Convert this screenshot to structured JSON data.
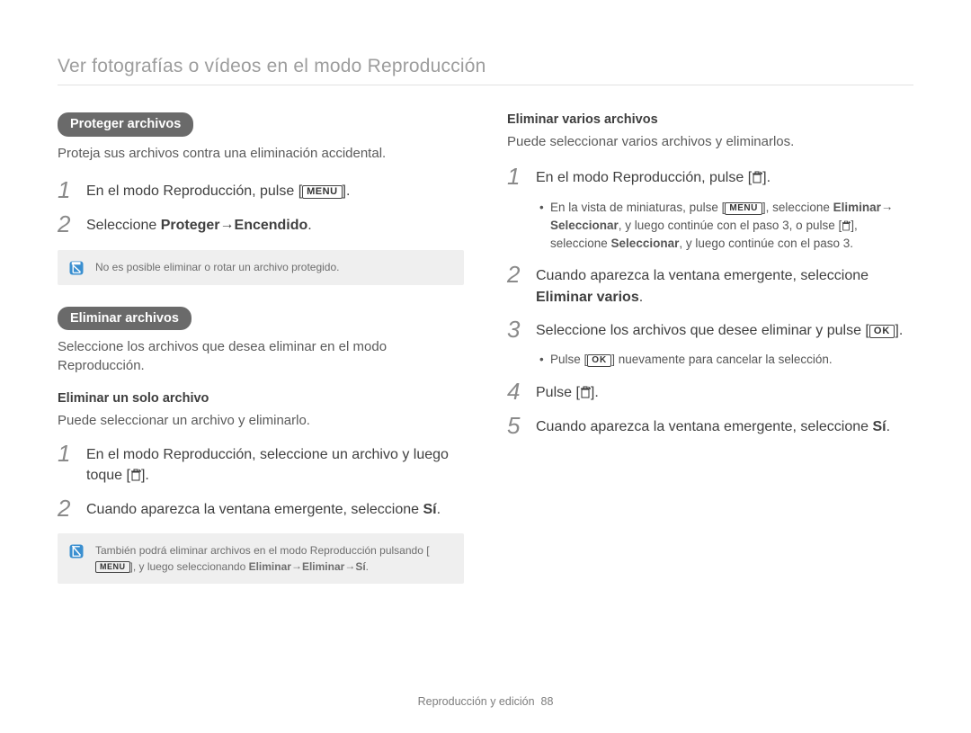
{
  "pageTitle": "Ver fotografías o vídeos en el modo Reproducción",
  "footer": {
    "section": "Reproducción y edición",
    "page": "88"
  },
  "buttons": {
    "menu": "MENU",
    "ok": "OK"
  },
  "left": {
    "protect": {
      "heading": "Proteger archivos",
      "lead": "Proteja sus archivos contra una eliminación accidental.",
      "step1_pre": "En el modo Reproducción, pulse [",
      "step1_post": "].",
      "step2_pre": "Seleccione ",
      "step2_bold1": "Proteger",
      "step2_arrow": " → ",
      "step2_bold2": "Encendido",
      "step2_post": ".",
      "note": "No es posible eliminar o rotar un archivo protegido."
    },
    "delete": {
      "heading": "Eliminar archivos",
      "lead": "Seleccione los archivos que desea eliminar en el modo Reproducción.",
      "single": {
        "sub": "Eliminar un solo archivo",
        "lead": "Puede seleccionar un archivo y eliminarlo.",
        "step1_a": "En el modo Reproducción, seleccione un archivo y luego toque [",
        "step1_b": "].",
        "step2_a": "Cuando aparezca la ventana emergente, seleccione ",
        "step2_bold": "Sí",
        "step2_b": "."
      },
      "note2_a": "También podrá eliminar archivos en el modo Reproducción pulsando [",
      "note2_b": "], y luego seleccionando ",
      "note2_path_1": "Eliminar",
      "note2_arrow": " → ",
      "note2_path_2": "Eliminar",
      "note2_path_3": "Sí",
      "note2_end": "."
    }
  },
  "right": {
    "multi": {
      "sub": "Eliminar varios archivos",
      "lead": "Puede seleccionar varios archivos y eliminarlos.",
      "step1_a": "En el modo Reproducción, pulse [",
      "step1_b": "].",
      "bullet1_a": "En la vista de miniaturas, pulse [",
      "bullet1_b": "], seleccione ",
      "bullet1_bold1": "Eliminar",
      "bullet1_arrow": " → ",
      "bullet1_bold2": "Seleccionar",
      "bullet1_c": ", y luego continúe con el paso 3, o pulse [",
      "bullet1_d": "], seleccione ",
      "bullet1_bold3": "Seleccionar",
      "bullet1_e": ", y luego continúe con el paso 3.",
      "step2_a": "Cuando aparezca la ventana emergente, seleccione ",
      "step2_bold": "Eliminar varios",
      "step2_b": ".",
      "step3_a": "Seleccione los archivos que desee eliminar y pulse [",
      "step3_b": "].",
      "bullet2_a": "Pulse [",
      "bullet2_b": "] nuevamente para cancelar la selección.",
      "step4_a": "Pulse [",
      "step4_b": "].",
      "step5_a": "Cuando aparezca la ventana emergente, seleccione ",
      "step5_bold": "Sí",
      "step5_b": "."
    }
  }
}
